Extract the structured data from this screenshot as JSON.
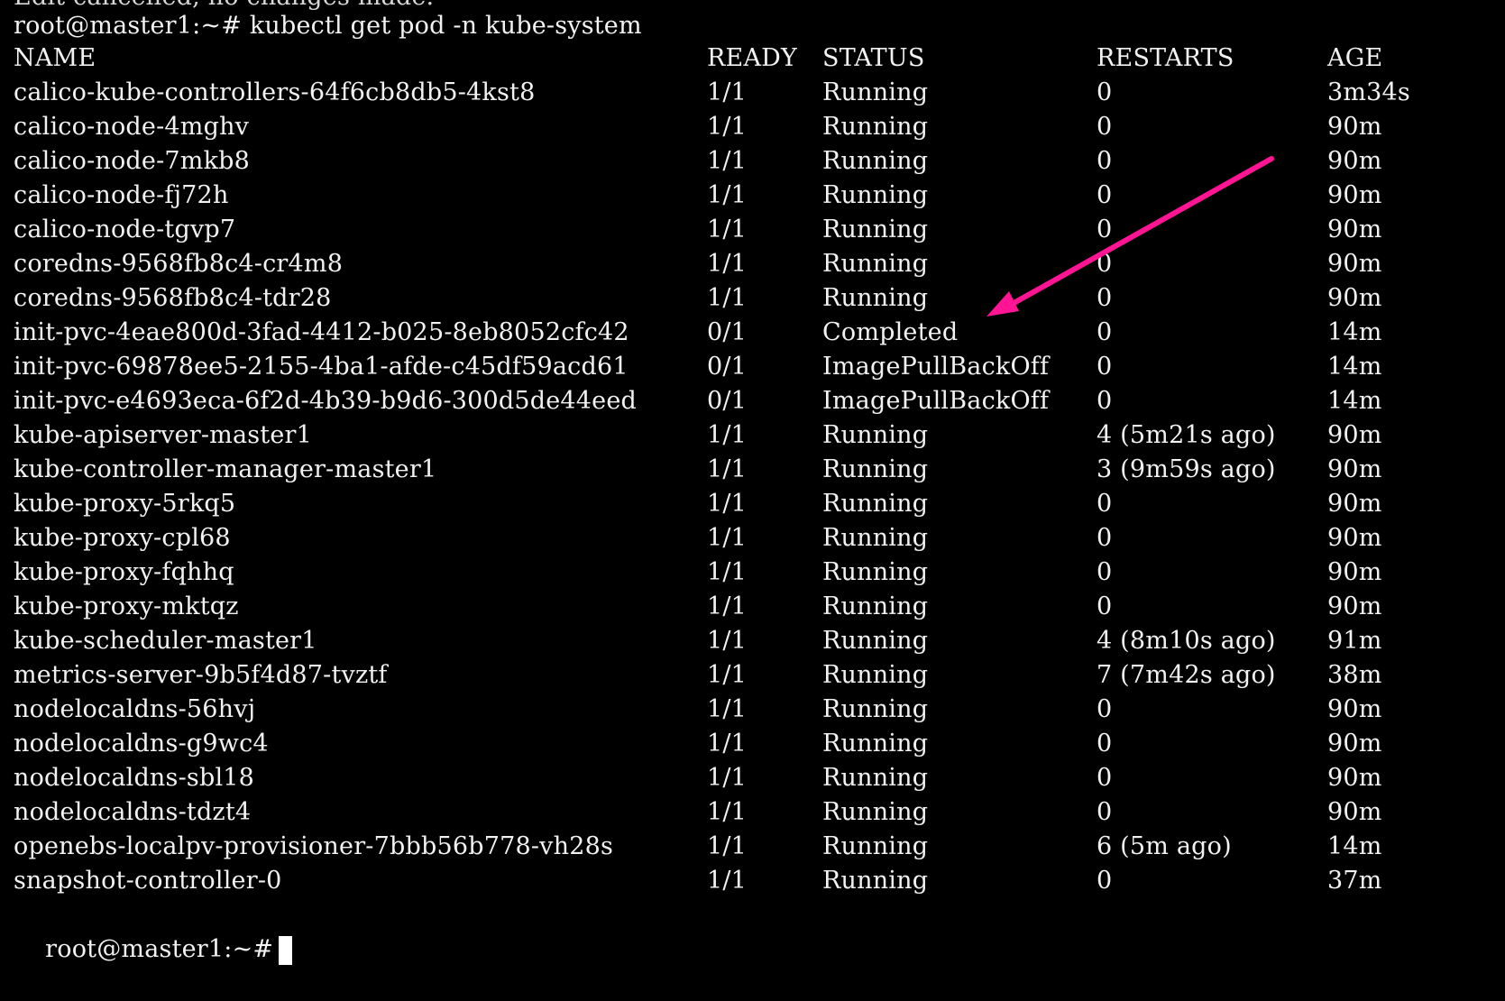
{
  "terminal": {
    "truncated_top_line": "Edit cancelled, no changes made.",
    "command_prompt": "root@master1:~# kubectl get pod -n kube-system",
    "final_prompt": "root@master1:~#",
    "headers": {
      "name": "NAME",
      "ready": "READY",
      "status": "STATUS",
      "restarts": "RESTARTS",
      "age": "AGE"
    },
    "rows": [
      {
        "name": "calico-kube-controllers-64f6cb8db5-4kst8",
        "ready": "1/1",
        "status": "Running",
        "restarts": "0",
        "age": "3m34s"
      },
      {
        "name": "calico-node-4mghv",
        "ready": "1/1",
        "status": "Running",
        "restarts": "0",
        "age": "90m"
      },
      {
        "name": "calico-node-7mkb8",
        "ready": "1/1",
        "status": "Running",
        "restarts": "0",
        "age": "90m"
      },
      {
        "name": "calico-node-fj72h",
        "ready": "1/1",
        "status": "Running",
        "restarts": "0",
        "age": "90m"
      },
      {
        "name": "calico-node-tgvp7",
        "ready": "1/1",
        "status": "Running",
        "restarts": "0",
        "age": "90m"
      },
      {
        "name": "coredns-9568fb8c4-cr4m8",
        "ready": "1/1",
        "status": "Running",
        "restarts": "0",
        "age": "90m"
      },
      {
        "name": "coredns-9568fb8c4-tdr28",
        "ready": "1/1",
        "status": "Running",
        "restarts": "0",
        "age": "90m"
      },
      {
        "name": "init-pvc-4eae800d-3fad-4412-b025-8eb8052cfc42",
        "ready": "0/1",
        "status": "Completed",
        "restarts": "0",
        "age": "14m"
      },
      {
        "name": "init-pvc-69878ee5-2155-4ba1-afde-c45df59acd61",
        "ready": "0/1",
        "status": "ImagePullBackOff",
        "restarts": "0",
        "age": "14m"
      },
      {
        "name": "init-pvc-e4693eca-6f2d-4b39-b9d6-300d5de44eed",
        "ready": "0/1",
        "status": "ImagePullBackOff",
        "restarts": "0",
        "age": "14m"
      },
      {
        "name": "kube-apiserver-master1",
        "ready": "1/1",
        "status": "Running",
        "restarts": "4 (5m21s ago)",
        "age": "90m"
      },
      {
        "name": "kube-controller-manager-master1",
        "ready": "1/1",
        "status": "Running",
        "restarts": "3 (9m59s ago)",
        "age": "90m"
      },
      {
        "name": "kube-proxy-5rkq5",
        "ready": "1/1",
        "status": "Running",
        "restarts": "0",
        "age": "90m"
      },
      {
        "name": "kube-proxy-cpl68",
        "ready": "1/1",
        "status": "Running",
        "restarts": "0",
        "age": "90m"
      },
      {
        "name": "kube-proxy-fqhhq",
        "ready": "1/1",
        "status": "Running",
        "restarts": "0",
        "age": "90m"
      },
      {
        "name": "kube-proxy-mktqz",
        "ready": "1/1",
        "status": "Running",
        "restarts": "0",
        "age": "90m"
      },
      {
        "name": "kube-scheduler-master1",
        "ready": "1/1",
        "status": "Running",
        "restarts": "4 (8m10s ago)",
        "age": "91m"
      },
      {
        "name": "metrics-server-9b5f4d87-tvztf",
        "ready": "1/1",
        "status": "Running",
        "restarts": "7 (7m42s ago)",
        "age": "38m"
      },
      {
        "name": "nodelocaldns-56hvj",
        "ready": "1/1",
        "status": "Running",
        "restarts": "0",
        "age": "90m"
      },
      {
        "name": "nodelocaldns-g9wc4",
        "ready": "1/1",
        "status": "Running",
        "restarts": "0",
        "age": "90m"
      },
      {
        "name": "nodelocaldns-sbl18",
        "ready": "1/1",
        "status": "Running",
        "restarts": "0",
        "age": "90m"
      },
      {
        "name": "nodelocaldns-tdzt4",
        "ready": "1/1",
        "status": "Running",
        "restarts": "0",
        "age": "90m"
      },
      {
        "name": "openebs-localpv-provisioner-7bbb56b778-vh28s",
        "ready": "1/1",
        "status": "Running",
        "restarts": "6 (5m ago)",
        "age": "14m"
      },
      {
        "name": "snapshot-controller-0",
        "ready": "1/1",
        "status": "Running",
        "restarts": "0",
        "age": "37m"
      }
    ]
  },
  "annotation": {
    "arrow_color": "#ff1493",
    "target": "Completed"
  },
  "colors": {
    "background": "#000000",
    "text": "#f2f2f2"
  }
}
